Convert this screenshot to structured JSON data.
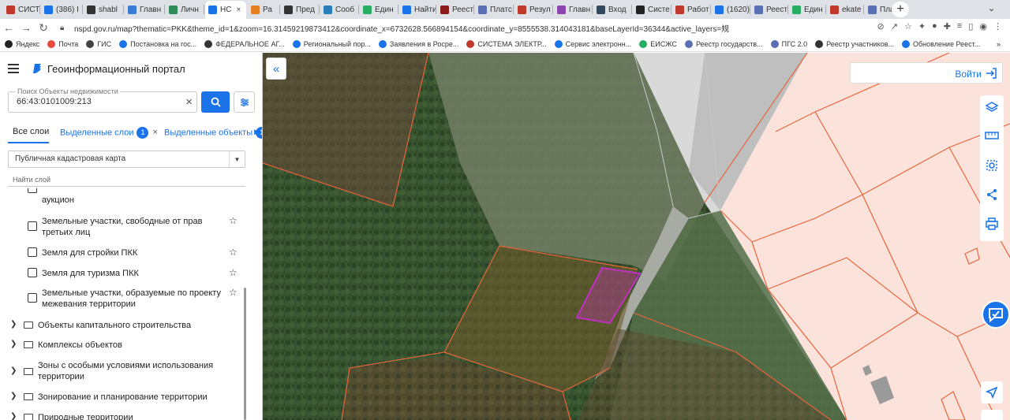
{
  "browser": {
    "tabs": [
      {
        "label": "СИСТ",
        "color": "#c0392b"
      },
      {
        "label": "(386) I",
        "color": "#1a73e8"
      },
      {
        "label": "shabl",
        "color": "#333333"
      },
      {
        "label": "Главн",
        "color": "#3a7bd5"
      },
      {
        "label": "Личн",
        "color": "#2e8b57"
      },
      {
        "label": "НС",
        "color": "#1a73e8",
        "active": true
      },
      {
        "label": "Ра",
        "color": "#e67e22"
      },
      {
        "label": "Пред",
        "color": "#333333"
      },
      {
        "label": "Сооб",
        "color": "#2980b9"
      },
      {
        "label": "Един",
        "color": "#27ae60"
      },
      {
        "label": "Найти",
        "color": "#1a73e8"
      },
      {
        "label": "Реест",
        "color": "#8b1a1a"
      },
      {
        "label": "Платс",
        "color": "#5b6fb5"
      },
      {
        "label": "Резул",
        "color": "#c0392b"
      },
      {
        "label": "Главн",
        "color": "#8e44ad"
      },
      {
        "label": "Вход",
        "color": "#34495e"
      },
      {
        "label": "Систе",
        "color": "#222222"
      },
      {
        "label": "Работ",
        "color": "#c0392b"
      },
      {
        "label": "(1620)",
        "color": "#1a73e8"
      },
      {
        "label": "Реест",
        "color": "#5b6fb5"
      },
      {
        "label": "Един",
        "color": "#27ae60"
      },
      {
        "label": "ekate",
        "color": "#c0392b"
      },
      {
        "label": "Плат",
        "color": "#5b6fb5"
      }
    ],
    "active_tab_close": "×",
    "url": "nspd.gov.ru/map?thematic=PKK&theme_id=1&zoom=16.31459219873412&coordinate_x=6732628.566894154&coordinate_y=8555538.314043181&baseLayerId=36344&active_layers=规",
    "bookmarks": [
      {
        "label": "Яндекс",
        "color": "#222222"
      },
      {
        "label": "Почта",
        "color": "#e74c3c"
      },
      {
        "label": "ГИС",
        "color": "#444444"
      },
      {
        "label": "Постановка на гос...",
        "color": "#1a73e8"
      },
      {
        "label": "ФЕДЕРАЛЬНОЕ АГ...",
        "color": "#333333"
      },
      {
        "label": "Региональный пор...",
        "color": "#1a73e8"
      },
      {
        "label": "Заявления в Росре...",
        "color": "#1a73e8"
      },
      {
        "label": "СИСТЕМА ЭЛЕКТР...",
        "color": "#c0392b"
      },
      {
        "label": "Сервис электронн...",
        "color": "#1a73e8"
      },
      {
        "label": "ЕИСЖС",
        "color": "#27ae60"
      },
      {
        "label": "Реестр государств...",
        "color": "#5b6fb5"
      },
      {
        "label": "ПГС 2.0",
        "color": "#5b6fb5"
      },
      {
        "label": "Реестр участников...",
        "color": "#333333"
      },
      {
        "label": "Обновление Реест...",
        "color": "#1a73e8"
      }
    ],
    "bookmarks_more": "»"
  },
  "header": {
    "title": "Геоинформационный портал"
  },
  "search": {
    "label": "Поиск Объекты недвижимости",
    "value": "66:43:0101009:213",
    "clear": "×"
  },
  "layer_tabs": {
    "all": "Все слои",
    "selected_layers": "Выделенные слои",
    "selected_layers_count": "1",
    "selected_layers_close": "×",
    "selected_objects": "Выделенные объекты",
    "selected_objects_count": "1"
  },
  "map_select": {
    "value": "Публичная кадастровая карта",
    "arrow": "▼"
  },
  "find_layer_placeholder": "Найти слой",
  "layers": [
    {
      "label": "аукцион"
    },
    {
      "label": "Земельные участки, свободные от прав третьих лиц"
    },
    {
      "label": "Земля для стройки ПКК"
    },
    {
      "label": "Земля для туризма ПКК"
    },
    {
      "label": "Земельные участки, образуемые по проекту межевания территории"
    }
  ],
  "groups": [
    {
      "label": "Объекты капитального строительства"
    },
    {
      "label": "Комплексы объектов"
    },
    {
      "label": "Зоны с особыми условиями использования территории"
    },
    {
      "label": "Зонирование и планирование территории"
    },
    {
      "label": "Природные территории"
    }
  ],
  "map": {
    "collapse": "«",
    "login": "Войти",
    "colors": {
      "parcel_outline": "#e8643c",
      "selected_parcel": "#c030c0",
      "accent": "#1a73e8"
    }
  }
}
